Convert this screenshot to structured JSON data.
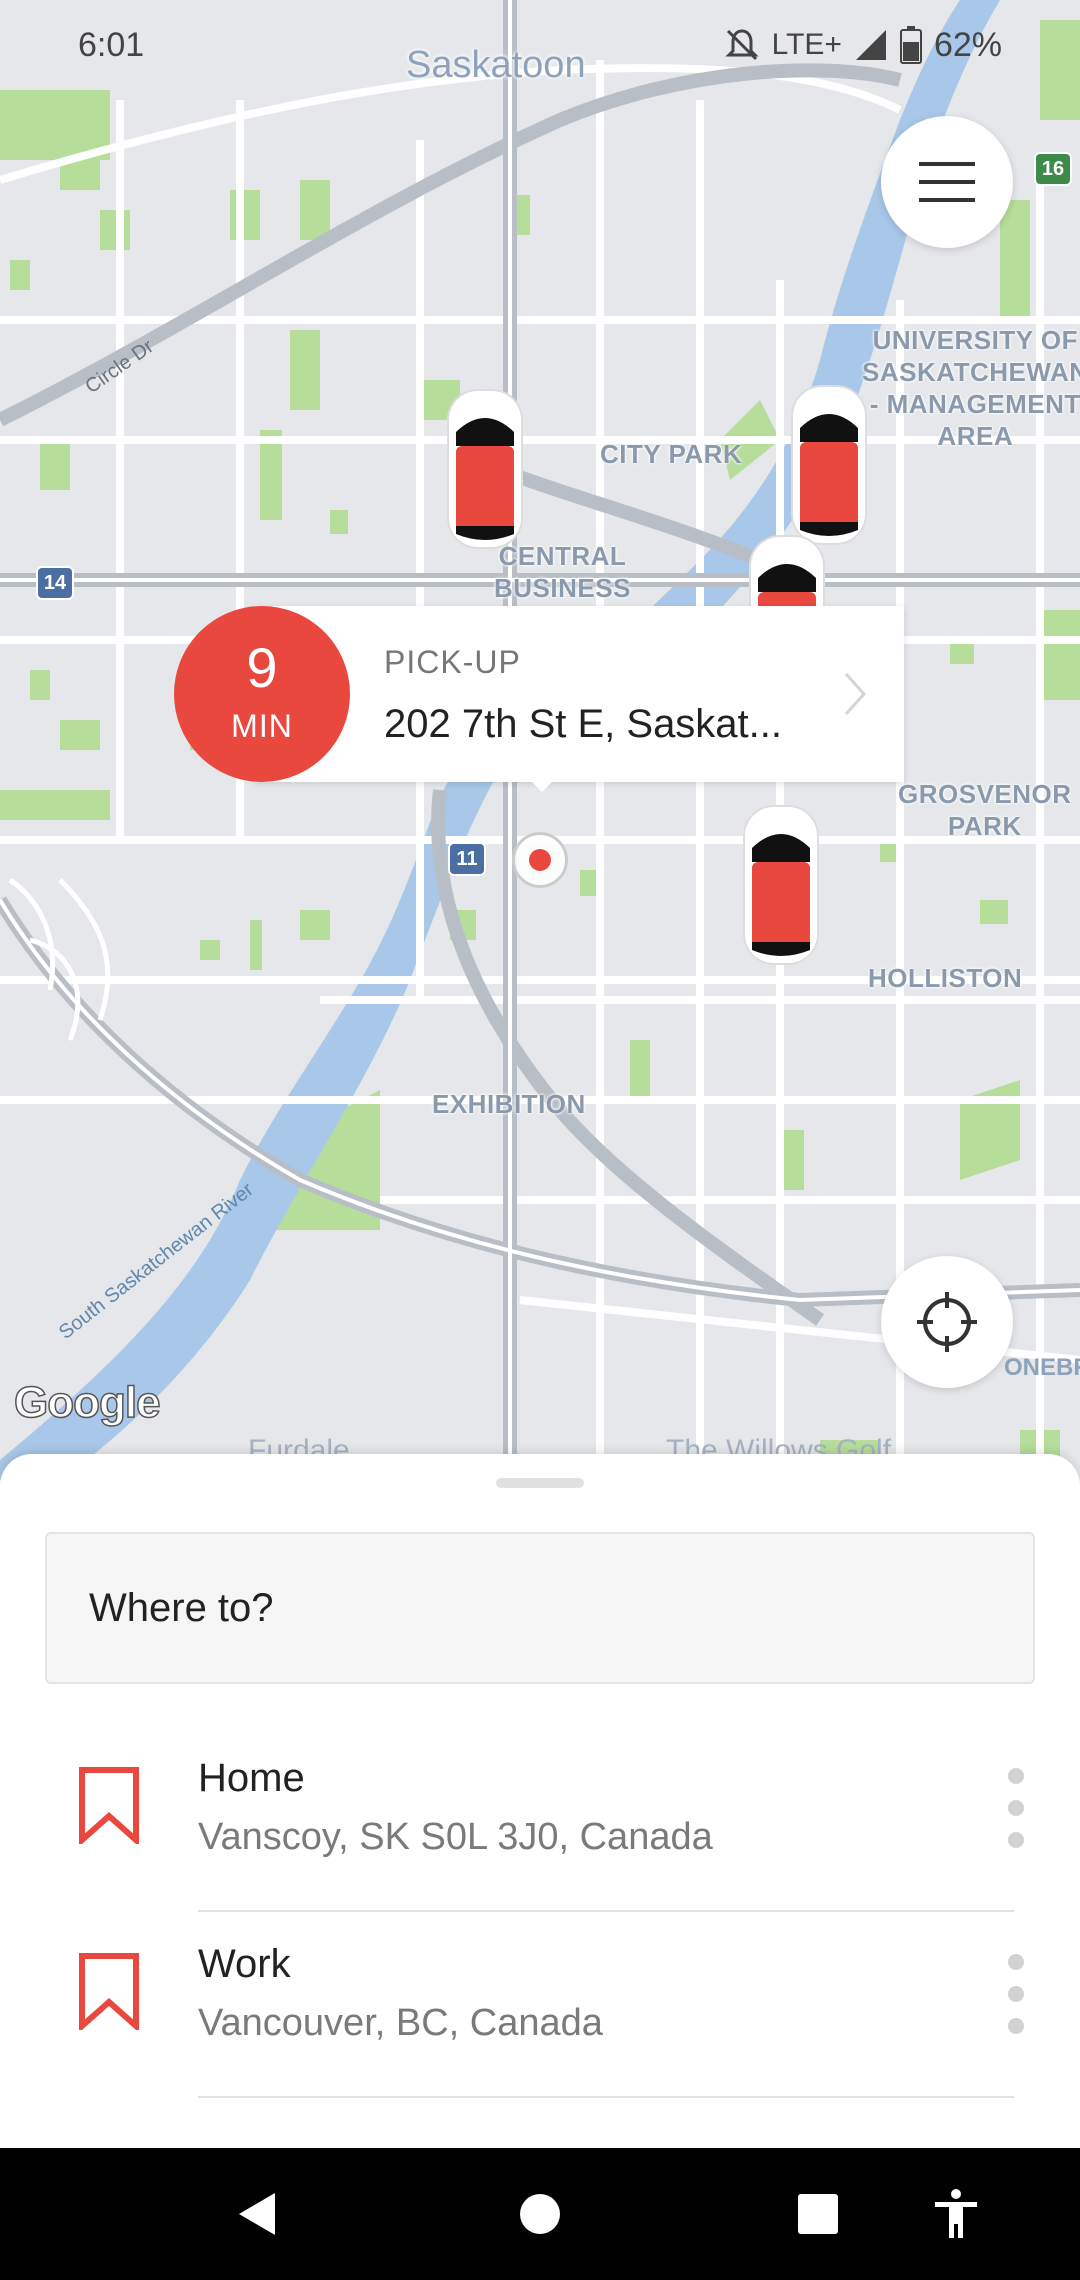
{
  "status_bar": {
    "time": "6:01",
    "network": "LTE+",
    "battery": "62%"
  },
  "map": {
    "city": "Saskatoon",
    "neighborhoods": [
      "CITY PARK",
      "CENTRAL\nBUSINESS",
      "UNIVERSITY OF\nSASKATCHEWAN\n- MANAGEMENT\nAREA",
      "GROSVENOR\nPARK",
      "HOLLISTON",
      "EXHIBITION"
    ],
    "river_label": "South Saskatchewan River",
    "road_label": "Circle Dr",
    "highway_14": "14",
    "highway_11": "11",
    "highway_16": "16",
    "partial_labels": [
      "Furdale",
      "The Willows Golf",
      "ONEBRID"
    ],
    "attribution": "Google"
  },
  "pickup": {
    "eta_value": "9",
    "eta_unit": "MIN",
    "label": "PICK-UP",
    "address": "202 7th St E, Saskat..."
  },
  "search": {
    "placeholder": "Where to?"
  },
  "saved_places": [
    {
      "name": "Home",
      "address": "Vanscoy, SK S0L 3J0, Canada",
      "icon": "bookmark-icon"
    },
    {
      "name": "Work",
      "address": "Vancouver, BC, Canada",
      "icon": "bookmark-icon"
    }
  ],
  "colors": {
    "accent": "#e9483f",
    "river": "#a9c7e8",
    "park": "#b6dd9a"
  }
}
